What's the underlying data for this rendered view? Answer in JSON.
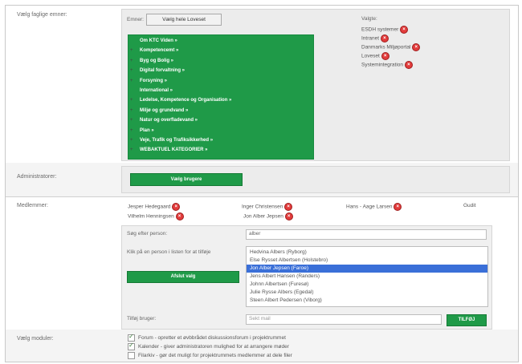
{
  "sections": {
    "faglige": {
      "label": "Vælg faglige emner:",
      "emner_label": "Emner:",
      "select_all_button": "Vælg hele Loveset",
      "tree": [
        {
          "label": "Om KTC Viden »",
          "expand": ""
        },
        {
          "label": "Kompetencemt »",
          "expand": "+"
        },
        {
          "label": "Byg og Bolig »",
          "expand": "+"
        },
        {
          "label": "Digital forvaltning »",
          "expand": "+"
        },
        {
          "label": "Forsyning »",
          "expand": "+"
        },
        {
          "label": "International »",
          "expand": ""
        },
        {
          "label": "Ledelse, Kompetence og Organisation »",
          "expand": "+"
        },
        {
          "label": "Miljø og grundvand »",
          "expand": "+"
        },
        {
          "label": "Natur og overfladevand »",
          "expand": "+"
        },
        {
          "label": "Plan »",
          "expand": "+"
        },
        {
          "label": "Veje, Trafik og Trafiksikkerhed »",
          "expand": "+"
        },
        {
          "label": "WEBAKTUEL KATEGORIER »",
          "expand": "+"
        }
      ],
      "valgte_label": "Valgte:",
      "valgte": [
        "ESDH systemer",
        "Intranet",
        "Danmarks Miljøportal",
        "Loveset",
        "Systemintegration"
      ]
    },
    "admin": {
      "label": "Administratorer:",
      "button": "Vælg brugere"
    },
    "medlemmer": {
      "label": "Medlemmer:",
      "members_row1": [
        "Jesper Hedegaard",
        "Inger Christensen",
        "Hans - Aage Larsen"
      ],
      "member_extra": "Gudit",
      "members_row2": [
        "Vilhelm Henningsen",
        "Jon Alber Jepsen"
      ],
      "search_label": "Søg efter person:",
      "search_value": "alber",
      "hint": "Klik på en person i listen for at tilføje",
      "afslut_button": "Afslut valg",
      "results": [
        "Hedvina Albers (Ryborg)",
        "Else Rysset Albertsen (Holstebro)",
        "Jon Alber Jepsen (Faroe)",
        "Jens Albert Hansen (Randers)",
        "Johnn Albertsen (Furesø)",
        "Julie Rysse Albers (Egedal)",
        "Steen Albert Pedersen (Viborg)"
      ],
      "selected_index": 2,
      "tilfoj_label": "Tilføj bruger:",
      "tilfoj_placeholder": "Sekt mail",
      "tilfoj_button": "TILFØJ"
    },
    "moduler": {
      "label": "Vælg moduler:",
      "items": [
        {
          "checked": true,
          "text": "Forum - opretter et øvbbrådet diskussionsforum i projektrummet"
        },
        {
          "checked": true,
          "text": "Kalender - giver administratoren mulighed for at arrangere møder"
        },
        {
          "checked": false,
          "text": "Filarkiv - gør det muligt for projektrummets medlemmer at dele filer"
        }
      ]
    }
  },
  "colors": {
    "accent_green": "#1f9a48",
    "remove_red": "#e23b3b",
    "selection_blue": "#3a6fd8"
  }
}
